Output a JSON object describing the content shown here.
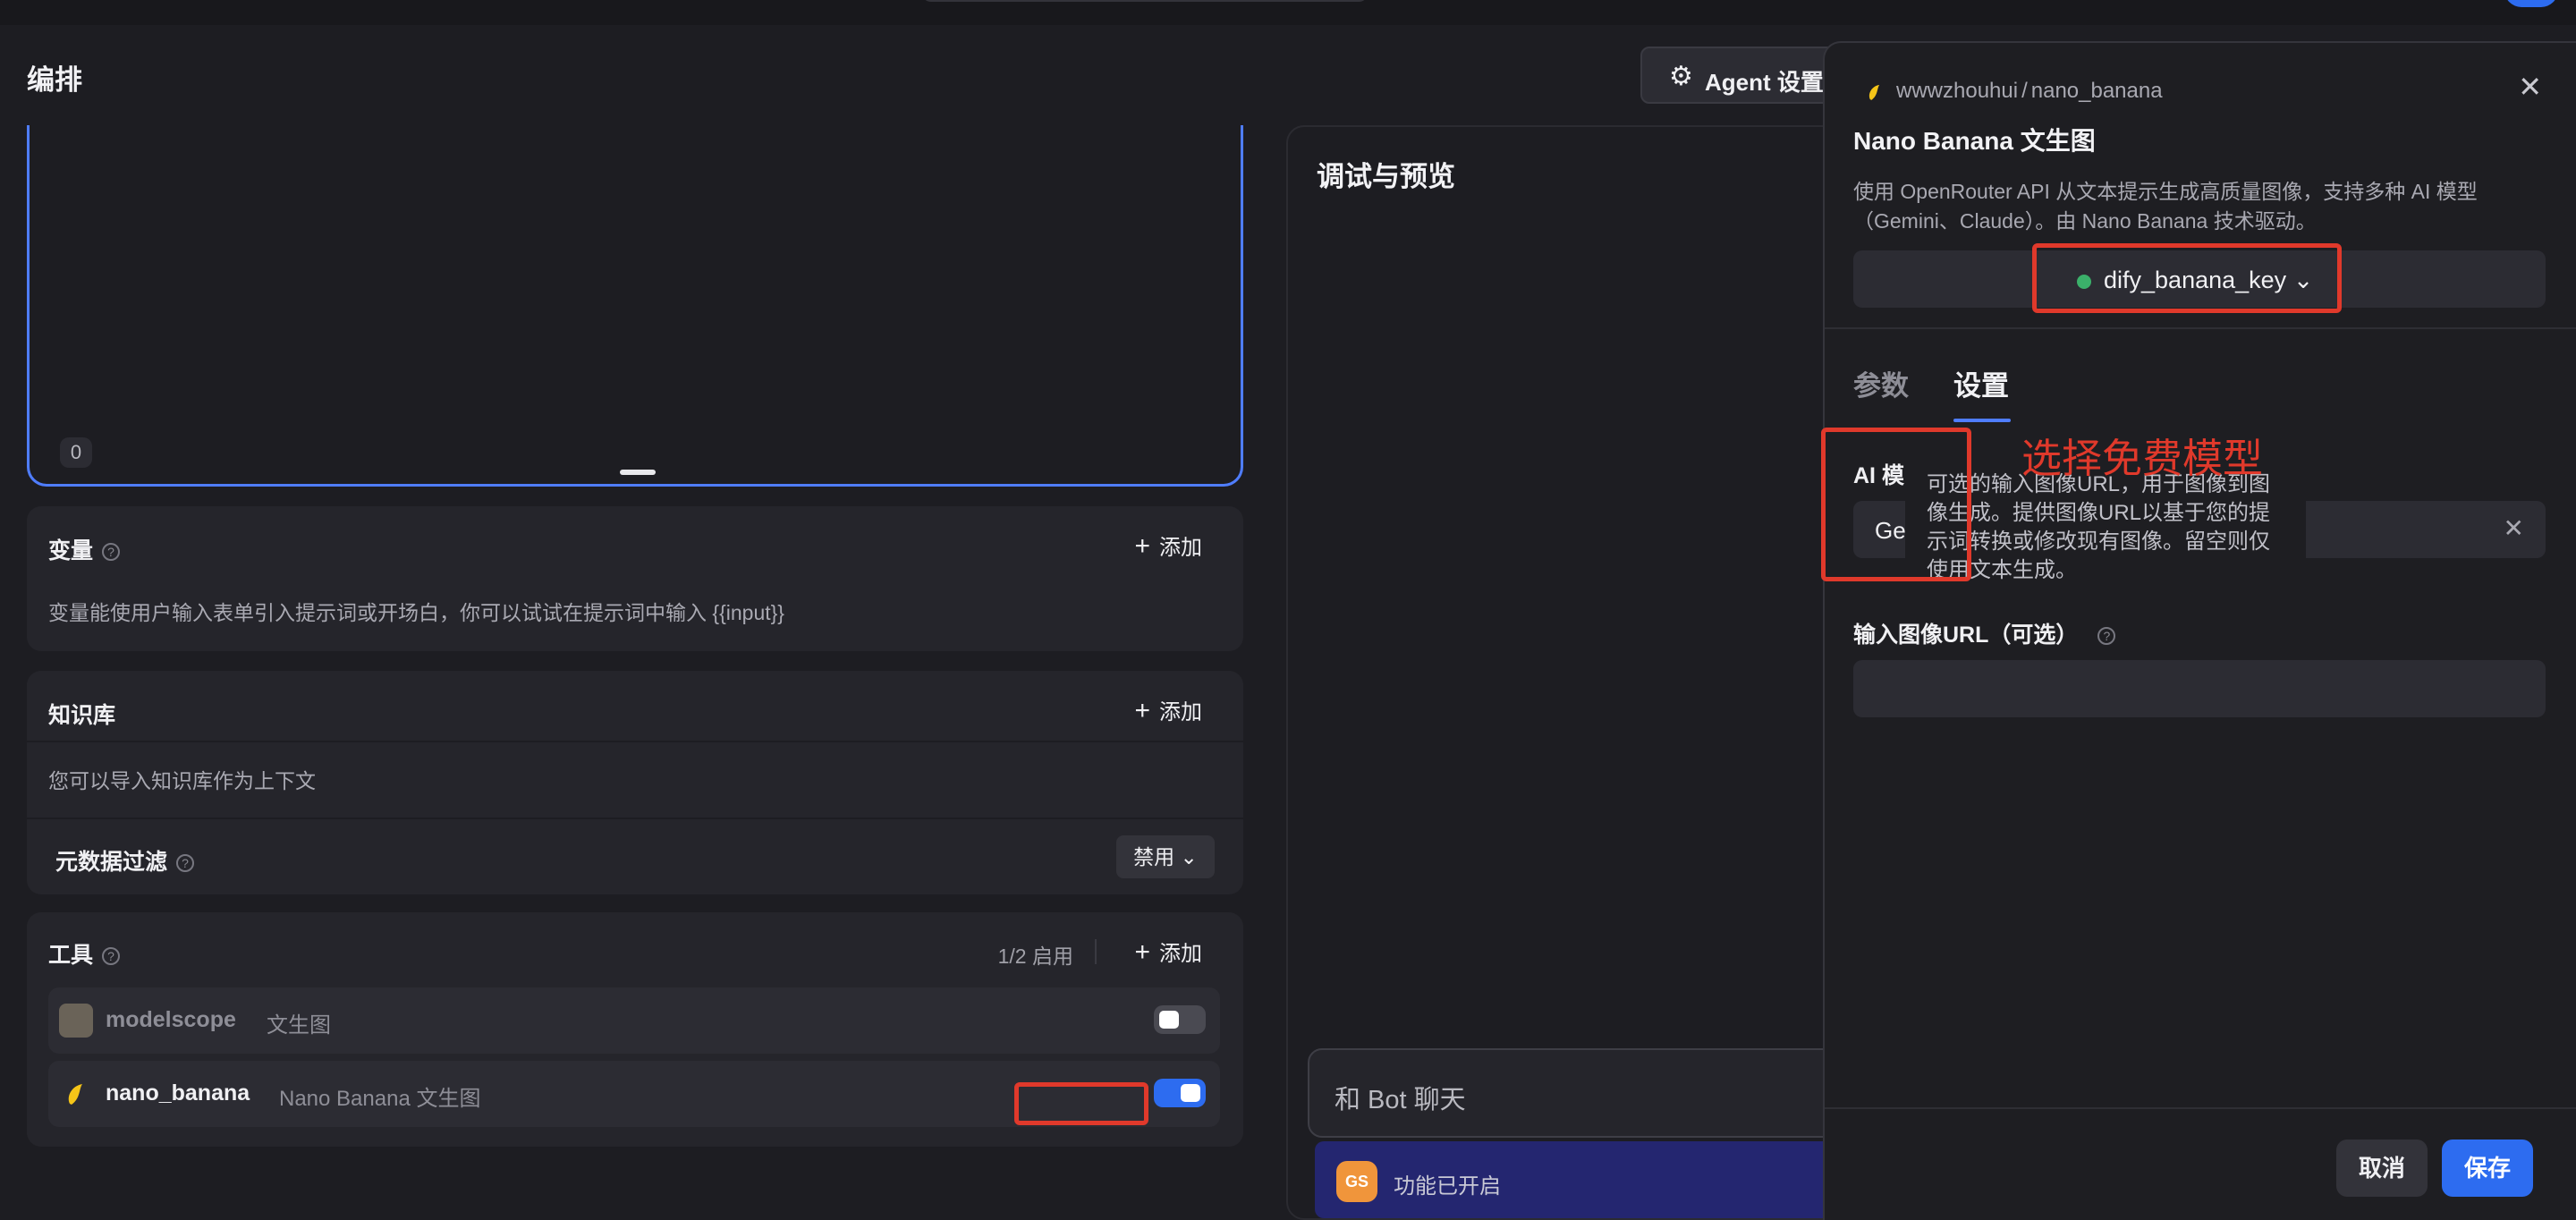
{
  "page": {
    "title": "编排"
  },
  "editor": {
    "char_count": "0"
  },
  "variables": {
    "title": "变量",
    "add_label": "添加",
    "description": "变量能使用户输入表单引入提示词或开场白，你可以试试在提示词中输入 {{input}}"
  },
  "knowledge": {
    "title": "知识库",
    "add_label": "添加",
    "description": "您可以导入知识库作为上下文",
    "metadata_filter_label": "元数据过滤",
    "metadata_filter_value": "禁用"
  },
  "tools": {
    "title": "工具",
    "enabled_count": "1/2 启用",
    "add_label": "添加",
    "items": [
      {
        "name": "modelscope",
        "subtitle": "文生图",
        "enabled": false
      },
      {
        "name": "nano_banana",
        "subtitle": "Nano Banana 文生图",
        "enabled": true
      }
    ]
  },
  "preview": {
    "title": "调试与预览",
    "chat_placeholder": "和 Bot 聊天",
    "feature_icon_text": "GS",
    "feature_status": "功能已开启"
  },
  "agent_settings": {
    "label": "Agent 设置"
  },
  "drawer": {
    "provider": "wwwzhouhui",
    "provider_sep": "/",
    "plugin": "nano_banana",
    "title": "Nano Banana 文生图",
    "description": "使用 OpenRouter API 从文本提示生成高质量图像，支持多种 AI 模型（Gemini、Claude）。由 Nano Banana 技术驱动。",
    "credential": "dify_banana_key",
    "tabs": [
      {
        "label": "参数",
        "active": false
      },
      {
        "label": "设置",
        "active": true
      }
    ],
    "ai_model_label": "AI 模",
    "ai_model_value": "Ge",
    "image_url_label": "输入图像URL（可选）",
    "tooltip": "可选的输入图像URL，用于图像到图像生成。提供图像URL以基于您的提示词转换或修改现有图像。留空则仅使用文本生成。",
    "cancel_label": "取消",
    "save_label": "保存"
  },
  "annotation": {
    "text": "选择免费模型",
    "color": "#e0392b"
  },
  "colors": {
    "accent": "#2d6cf0",
    "focus_border": "#4f7dff",
    "annotation": "#e0392b",
    "status_ok": "#3bb06a"
  }
}
